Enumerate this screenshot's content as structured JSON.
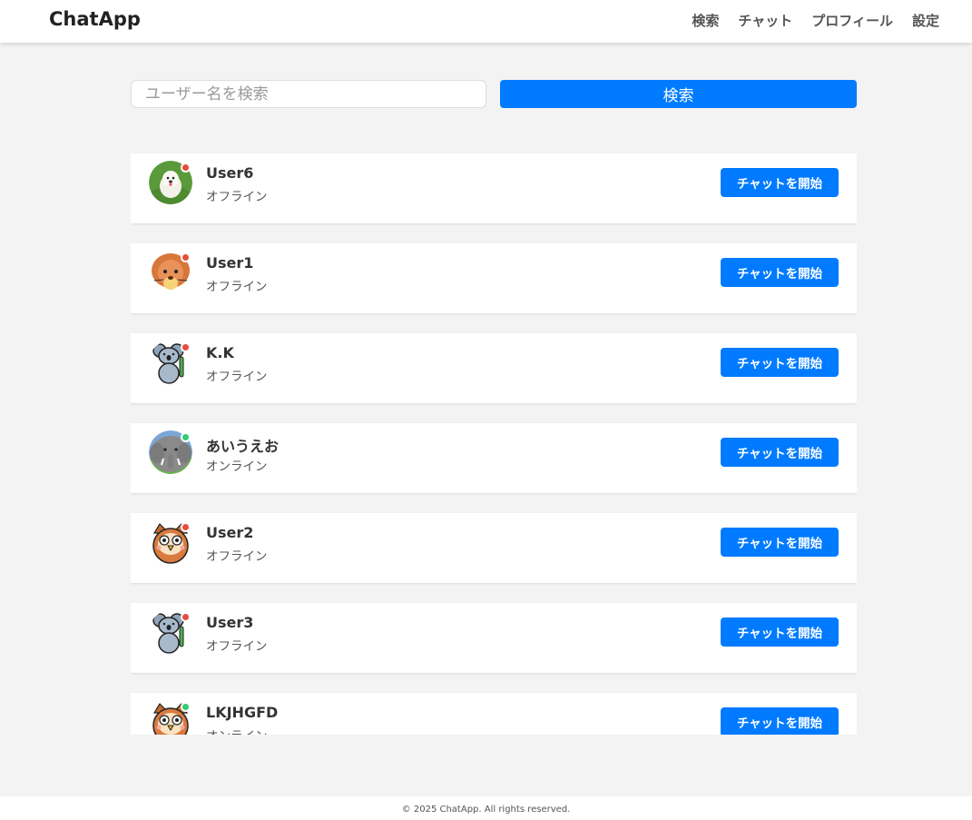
{
  "header": {
    "brand": "ChatApp",
    "nav": [
      {
        "label": "検索"
      },
      {
        "label": "チャット"
      },
      {
        "label": "プロフィール"
      },
      {
        "label": "設定"
      }
    ]
  },
  "search": {
    "placeholder": "ユーザー名を検索",
    "value": "",
    "button_label": "検索"
  },
  "users": [
    {
      "name": "User6",
      "status": "オフライン",
      "online": false,
      "avatar_icon": "dog-photo-icon",
      "button_label": "チャットを開始"
    },
    {
      "name": "User1",
      "status": "オフライン",
      "online": false,
      "avatar_icon": "lion-icon",
      "button_label": "チャットを開始"
    },
    {
      "name": "K.K",
      "status": "オフライン",
      "online": false,
      "avatar_icon": "koala-icon",
      "button_label": "チャットを開始"
    },
    {
      "name": "あいうえお",
      "status": "オンライン",
      "online": true,
      "avatar_icon": "elephant-icon",
      "button_label": "チャットを開始"
    },
    {
      "name": "User2",
      "status": "オフライン",
      "online": false,
      "avatar_icon": "owl-icon",
      "button_label": "チャットを開始"
    },
    {
      "name": "User3",
      "status": "オフライン",
      "online": false,
      "avatar_icon": "koala-icon",
      "button_label": "チャットを開始"
    },
    {
      "name": "LKJHGFD",
      "status": "オンライン",
      "online": true,
      "avatar_icon": "owl-icon",
      "button_label": "チャットを開始"
    }
  ],
  "colors": {
    "accent": "#007bff",
    "online": "#2ecc71",
    "offline": "#e74c3c"
  },
  "footer": {
    "text": "© 2025 ChatApp. All rights reserved."
  }
}
